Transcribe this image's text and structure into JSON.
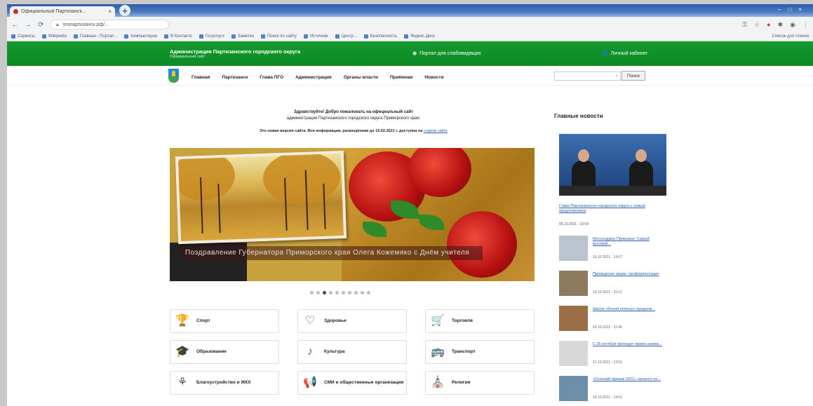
{
  "browser": {
    "tab_title": "Официальный Партизанск...",
    "url": "пгопартизанск.рф/...",
    "bookmarks": [
      "Сервисы",
      "Wikipedia",
      "Главная - Портал...",
      "Компьютерно",
      "В Контакте",
      "Госуслуги",
      "Заметки",
      "Поиск по сайту",
      "Источник",
      "Центр...",
      "Безопасность",
      "Яндекс.Диск"
    ],
    "bookmarks_more": "Список для чтения"
  },
  "header": {
    "site_title": "Администрация Партизанского городского округа",
    "site_subtitle": "Официальный сайт",
    "portal_link": "Портал для слабовидящих",
    "cabinet_link": "Личный кабинет"
  },
  "nav": {
    "items": [
      "Главная",
      "Партизанск",
      "Глава ПГО",
      "Администрация",
      "Органы власти",
      "Приёмная",
      "Новости"
    ],
    "search_placeholder": "",
    "search_button": "Поиск"
  },
  "welcome": {
    "line1": "Здравствуйте! Добро пожаловать на официальный сайт",
    "line2": "администрации Партизанского городского округа Приморского края.",
    "notice": "Это новая версия сайта. Вся информация, размещённая до 15.02.2021 г. доступна на",
    "notice_link": "старом сайте"
  },
  "slider": {
    "caption": "Поздравление Губернатора Приморского края Олега Кожемяко с Днём учителя",
    "dot_count": 10,
    "active_dot": 2
  },
  "categories": [
    {
      "label": "Спорт",
      "icon": "trophy-icon",
      "glyph": "🏆"
    },
    {
      "label": "Здоровье",
      "icon": "heart-icon",
      "glyph": "♡"
    },
    {
      "label": "Торговля",
      "icon": "cart-icon",
      "glyph": "🛒"
    },
    {
      "label": "Образование",
      "icon": "graduation-icon",
      "glyph": "🎓"
    },
    {
      "label": "Культура",
      "icon": "culture-icon",
      "glyph": "♪"
    },
    {
      "label": "Транспорт",
      "icon": "bus-icon",
      "glyph": "🚌"
    },
    {
      "label": "Благоустройство и ЖКХ",
      "icon": "watering-icon",
      "glyph": "⚘"
    },
    {
      "label": "СМИ и общественные организации",
      "icon": "megaphone-icon",
      "glyph": "📢"
    },
    {
      "label": "Религия",
      "icon": "church-icon",
      "glyph": "⛪"
    }
  ],
  "news": {
    "title": "Главные новости",
    "main_link": "Глава Партизанского городского округа с новым предложением",
    "main_date": "06.10.2021 - 10:54",
    "items": [
      {
        "link": "Мессенджер Приморье: Самый высокий...",
        "date": "15.10.2021 - 14:07"
      },
      {
        "link": "Проведение акции: профориентация",
        "date": "19.10.2021 - 15:11"
      },
      {
        "link": "Школа «Белой полосы» продолж...",
        "date": "20.10.2021 - 11:08"
      },
      {
        "link": "С 25 октября проходит прием заявок...",
        "date": "21.10.2021 - 13:51"
      },
      {
        "link": "«Осенний призыв 2021» начался на...",
        "date": "19.10.2021 - 14:51"
      }
    ]
  },
  "colors": {
    "header_green": "#0d8a24",
    "link_blue": "#2a5db0"
  }
}
